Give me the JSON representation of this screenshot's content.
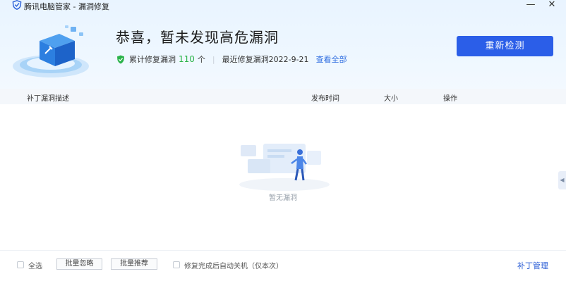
{
  "window": {
    "title": "腾讯电脑管家 - 漏洞修复",
    "minimize_label": "—",
    "close_label": "✕"
  },
  "summary": {
    "headline": "恭喜，暂未发现高危漏洞",
    "fixed_prefix": "累计修复漏洞",
    "fixed_count": "110",
    "fixed_unit": "个",
    "separator": "|",
    "last_fix": "最近修复漏洞2022-9-21",
    "view_all": "查看全部",
    "status_color": "#2bb34a"
  },
  "recheck_button": "重新检测",
  "table": {
    "columns": [
      "补丁漏洞描述",
      "发布时间",
      "大小",
      "操作"
    ],
    "empty_text": "暂无漏洞"
  },
  "side_tab_glyph": "◀",
  "footer": {
    "select_all": "全选",
    "batch_ignore": "批量忽略",
    "batch_recommend": "批量推荐",
    "auto_shutdown": "修复完成后自动关机（仅本次）",
    "patch_manage": "补丁管理"
  },
  "colors": {
    "primary": "#2b5ee8",
    "link": "#2d6ce0",
    "header_bg": "#e9f4ff"
  },
  "icons": {
    "app_logo": "tencent-shield-icon",
    "status": "green-shield-check-icon"
  }
}
